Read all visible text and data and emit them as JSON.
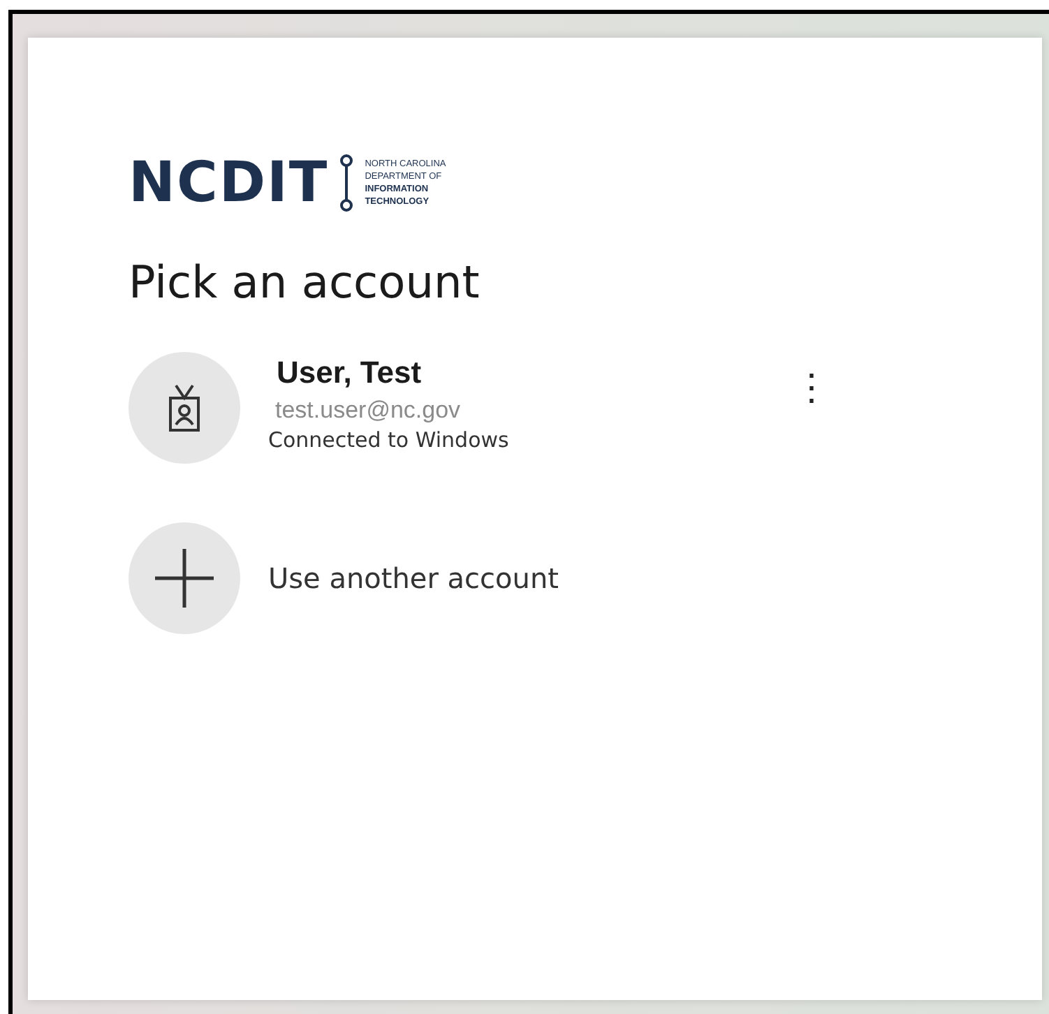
{
  "logo": {
    "wordmark": "NCDIT",
    "lines": [
      "NORTH CAROLINA",
      "DEPARTMENT OF",
      "INFORMATION",
      "TECHNOLOGY"
    ]
  },
  "title": "Pick an account",
  "accounts": [
    {
      "kind": "account",
      "name": "User, Test",
      "email": "test.user@nc.gov",
      "status": "Connected to Windows",
      "menu": "⋮"
    },
    {
      "kind": "add",
      "label": "Use another account"
    }
  ]
}
